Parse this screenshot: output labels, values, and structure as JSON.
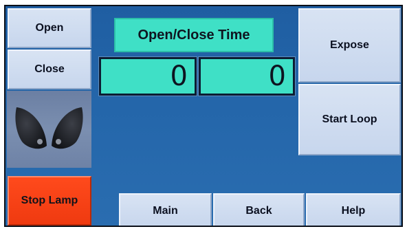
{
  "left_panel": {
    "open_label": "Open",
    "close_label": "Close",
    "stop_lamp_label": "Stop Lamp"
  },
  "center": {
    "title": "Open/Close Time",
    "open_time_value": "0",
    "close_time_value": "0"
  },
  "right_panel": {
    "expose_label": "Expose",
    "start_loop_label": "Start Loop"
  },
  "bottom_nav": {
    "main_label": "Main",
    "back_label": "Back",
    "help_label": "Help"
  },
  "icons": {
    "shutter": "shutter-blades-icon"
  },
  "colors": {
    "screen_bg": "#2466aa",
    "button_bg": "#c7d6ed",
    "stop_button_bg": "#ef3a10",
    "display_bg": "#3fe0c6"
  }
}
